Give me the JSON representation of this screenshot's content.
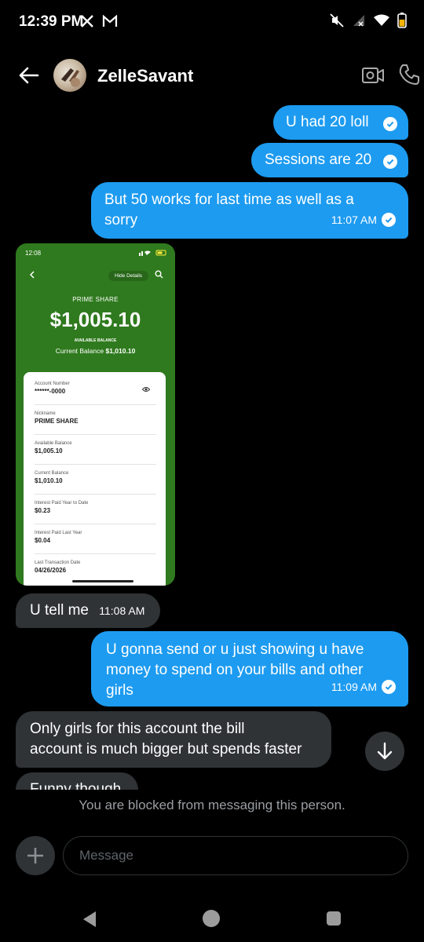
{
  "status_bar": {
    "time": "12:39 PM"
  },
  "header": {
    "contact_name": "ZelleSavant"
  },
  "messages": [
    {
      "type": "sent",
      "text": "U had 20 loll"
    },
    {
      "type": "sent",
      "text": "Sessions are 20"
    },
    {
      "type": "sent",
      "text_line1": "But 50 works for last time as well as a",
      "text_line2": "sorry",
      "time": "11:07 AM"
    },
    {
      "type": "received-image"
    },
    {
      "type": "received",
      "text": "U tell me",
      "time": "11:08 AM"
    },
    {
      "type": "sent",
      "text_line1": "U gonna send or u just showing u have",
      "text_line2": "money to spend on your bills and other",
      "text_line3": "girls",
      "time": "11:09 AM"
    },
    {
      "type": "received",
      "text_line1": "Only girls for this account the bill",
      "text_line2": "account is much bigger but spends faster"
    },
    {
      "type": "received",
      "text": "Funny though"
    }
  ],
  "bank_screenshot": {
    "status_time": "12:08",
    "hide_details": "Hide Details",
    "account_title": "PRIME SHARE",
    "amount": "$1,005.10",
    "available_label": "AVAILABLE BALANCE",
    "current_balance_label": "Current Balance",
    "current_balance_value": "$1,010.10",
    "rows": [
      {
        "label": "Account Number",
        "value": "******-0000"
      },
      {
        "label": "Nickname",
        "value": "PRIME SHARE"
      },
      {
        "label": "Available Balance",
        "value": "$1,005.10"
      },
      {
        "label": "Current Balance",
        "value": "$1,010.10"
      },
      {
        "label": "Interest Paid Year to Date",
        "value": "$0.23"
      },
      {
        "label": "Interest Paid Last Year",
        "value": "$0.04"
      },
      {
        "label": "Last Transaction Date",
        "value": "04/26/2026"
      }
    ]
  },
  "blocked_notice": "You are blocked from messaging this person.",
  "composer": {
    "placeholder": "Message"
  },
  "colors": {
    "sent_bubble": "#1d9bf0",
    "received_bubble": "#2f3336",
    "bank_green": "#2f7a1e"
  }
}
